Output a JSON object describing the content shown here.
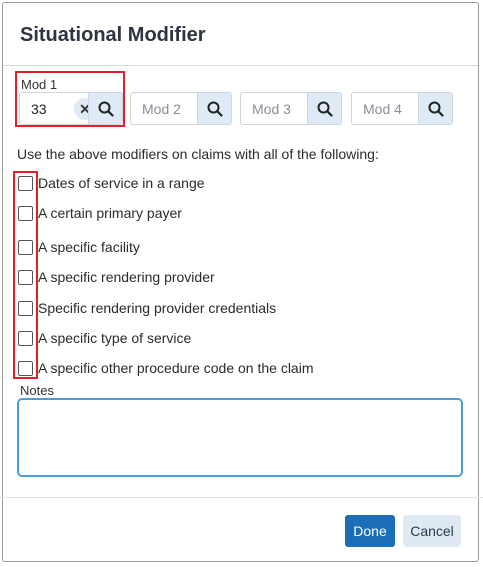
{
  "dialog": {
    "title": "Situational Modifier"
  },
  "modifiers": {
    "label": "Mod 1",
    "fields": [
      {
        "value": "33",
        "placeholder": ""
      },
      {
        "value": "",
        "placeholder": "Mod 2"
      },
      {
        "value": "",
        "placeholder": "Mod 3"
      },
      {
        "value": "",
        "placeholder": "Mod 4"
      }
    ],
    "clear_glyph": "✕"
  },
  "instruction": "Use the above modifiers on claims with all of the following:",
  "conditions": [
    {
      "label": "Dates of service in a range",
      "checked": false
    },
    {
      "label": "A certain primary payer",
      "checked": false
    },
    {
      "label": "A specific facility",
      "checked": false
    },
    {
      "label": "A specific rendering provider",
      "checked": false
    },
    {
      "label": "Specific rendering provider credentials",
      "checked": false
    },
    {
      "label": "A specific type of service",
      "checked": false
    },
    {
      "label": "A specific other procedure code on the claim",
      "checked": false
    }
  ],
  "notes": {
    "label": "Notes",
    "value": ""
  },
  "actions": {
    "done_label": "Done",
    "cancel_label": "Cancel"
  },
  "colors": {
    "primary": "#1b6fb6",
    "secondary": "#dfe9f3",
    "highlight": "#e0202a",
    "focus_border": "#4a9fd6"
  },
  "icons": {
    "search": "search-icon",
    "clear": "close-icon"
  }
}
